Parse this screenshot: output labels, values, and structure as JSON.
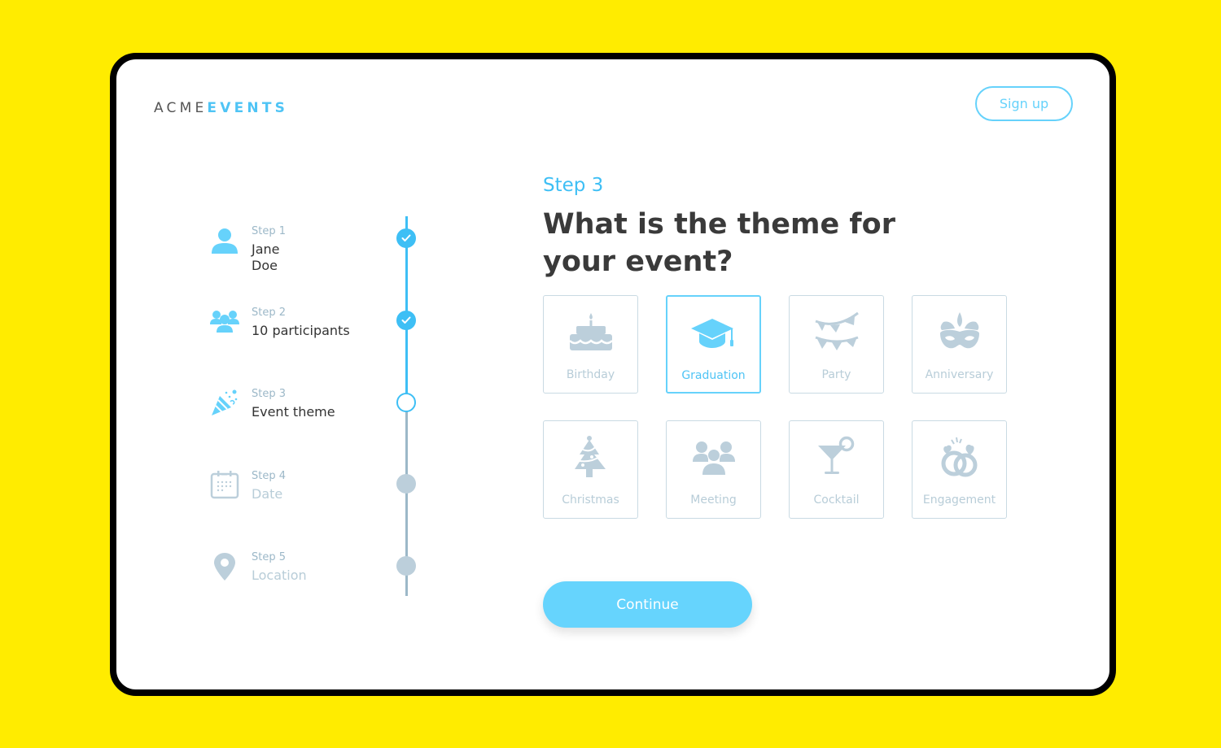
{
  "app": {
    "logo_part1": "ACME",
    "logo_part2": "EVENTS"
  },
  "header": {
    "signup_label": "Sign up"
  },
  "colors": {
    "accent": "#3EBFF5",
    "accent_light": "#66D4FD",
    "muted": "#BCCFDB",
    "background": "#FFEC00"
  },
  "stepper": {
    "steps": [
      {
        "label": "Step 1",
        "value": "Jane\nDoe",
        "value_line1": "Jane",
        "value_line2": "Doe",
        "status": "done",
        "icon": "person-icon"
      },
      {
        "label": "Step 2",
        "value": "10 participants",
        "status": "done",
        "icon": "group-icon"
      },
      {
        "label": "Step 3",
        "value": "Event theme",
        "status": "current",
        "icon": "party-popper-icon"
      },
      {
        "label": "Step 4",
        "value": "Date",
        "status": "future",
        "icon": "calendar-icon"
      },
      {
        "label": "Step 5",
        "value": "Location",
        "status": "future",
        "icon": "location-pin-icon"
      }
    ]
  },
  "main": {
    "kicker": "Step 3",
    "question": "What is the theme for your event?",
    "themes": [
      {
        "label": "Birthday",
        "icon": "cake-icon",
        "selected": false
      },
      {
        "label": "Graduation",
        "icon": "graduation-cap-icon",
        "selected": true
      },
      {
        "label": "Party",
        "icon": "bunting-icon",
        "selected": false
      },
      {
        "label": "Anniversary",
        "icon": "mask-icon",
        "selected": false
      },
      {
        "label": "Christmas",
        "icon": "christmas-tree-icon",
        "selected": false
      },
      {
        "label": "Meeting",
        "icon": "group-icon",
        "selected": false
      },
      {
        "label": "Cocktail",
        "icon": "cocktail-icon",
        "selected": false
      },
      {
        "label": "Engagement",
        "icon": "rings-icon",
        "selected": false
      }
    ],
    "continue_label": "Continue"
  }
}
